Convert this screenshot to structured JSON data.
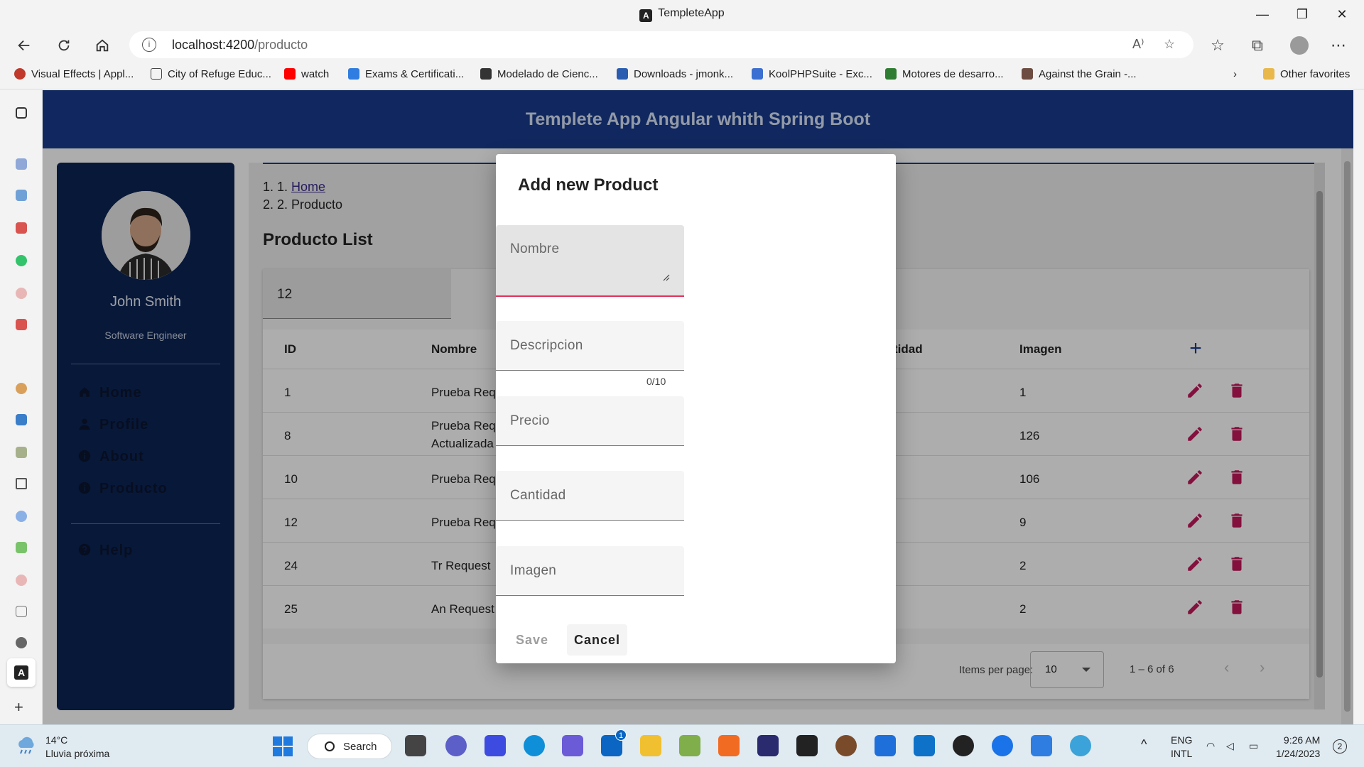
{
  "window": {
    "title": "TempleteApp",
    "minimize": "—",
    "maximize": "❐",
    "close": "✕"
  },
  "browser": {
    "url_host": "localhost:4200",
    "url_path": "/producto",
    "favorites": [
      "Visual Effects | Appl...",
      "City of Refuge Educ...",
      "watch",
      "Exams & Certificati...",
      "Modelado de Cienc...",
      "Downloads - jmonk...",
      "KoolPHPSuite - Exc...",
      "Motores de desarro...",
      "Against the Grain -...",
      "Other favorites"
    ],
    "favorite_colors": [
      "#c0392b",
      "#444444",
      "#ff0000",
      "#2f7de1",
      "#333333",
      "#2a5db0",
      "#3b6fd1",
      "#2e7d32",
      "#6d4c41",
      "#e8b84a"
    ]
  },
  "app": {
    "header_title": "Templete App Angular whith Spring Boot",
    "colors": {
      "header": "#183c8c",
      "sidebar": "#0d2454",
      "accent": "#e0315b",
      "action": "#c2185b"
    }
  },
  "sidebar": {
    "user_name": "John Smith",
    "user_role": "Software Engineer",
    "nav": [
      {
        "label": "Home",
        "icon": "home-icon"
      },
      {
        "label": "Profile",
        "icon": "person-icon"
      },
      {
        "label": "About",
        "icon": "info-icon"
      },
      {
        "label": "Producto",
        "icon": "info-icon"
      }
    ],
    "help": {
      "label": "Help",
      "icon": "help-icon"
    }
  },
  "breadcrumb": {
    "items": [
      "Home",
      "Producto"
    ]
  },
  "list": {
    "title": "Producto List",
    "filter_value": "12",
    "columns": [
      "ID",
      "Nombre",
      "tidad",
      "Imagen"
    ],
    "rows": [
      {
        "id": "1",
        "nombre": "Prueba Req",
        "nombre2": "",
        "imagen": "1"
      },
      {
        "id": "8",
        "nombre": "Prueba Req",
        "nombre2": "Actualizada",
        "imagen": "126"
      },
      {
        "id": "10",
        "nombre": "Prueba Req",
        "nombre2": "",
        "imagen": "106"
      },
      {
        "id": "12",
        "nombre": "Prueba Req",
        "nombre2": "",
        "imagen": "9"
      },
      {
        "id": "24",
        "nombre": "Tr Request",
        "nombre2": "",
        "imagen": "2"
      },
      {
        "id": "25",
        "nombre": "An Request",
        "nombre2": "",
        "imagen": "2"
      }
    ],
    "paginator": {
      "items_per_page_label": "Items per page:",
      "page_size": "10",
      "range": "1 – 6 of 6",
      "prev": "‹",
      "next": "›"
    }
  },
  "dialog": {
    "title": "Add new Product",
    "fields": {
      "nombre": {
        "label": "Nombre",
        "value": ""
      },
      "descripcion": {
        "label": "Descripcion",
        "value": "",
        "counter": "0/10"
      },
      "precio": {
        "label": "Precio",
        "value": ""
      },
      "cantidad": {
        "label": "Cantidad",
        "value": ""
      },
      "imagen": {
        "label": "Imagen",
        "value": ""
      }
    },
    "save_label": "Save",
    "cancel_label": "Cancel"
  },
  "taskbar": {
    "weather_temp": "14°C",
    "weather_desc": "Lluvia próxima",
    "search_label": "Search",
    "mail_badge": "1",
    "lang_top": "ENG",
    "lang_bottom": "INTL",
    "time": "9:26 AM",
    "date": "1/24/2023",
    "notification_count": "2",
    "app_colors": [
      "#444444",
      "#5b5fc7",
      "#3e4be0",
      "#0f8fd8",
      "#6b5bd6",
      "#0a66c2",
      "#f0c030",
      "#7fae4b",
      "#f26b22",
      "#2a2a6e",
      "#222222",
      "#7a4b2a",
      "#1e6fd9",
      "#0e72c9",
      "#222222",
      "#1a73e8",
      "#2f7de1",
      "#3ba3d9"
    ]
  }
}
